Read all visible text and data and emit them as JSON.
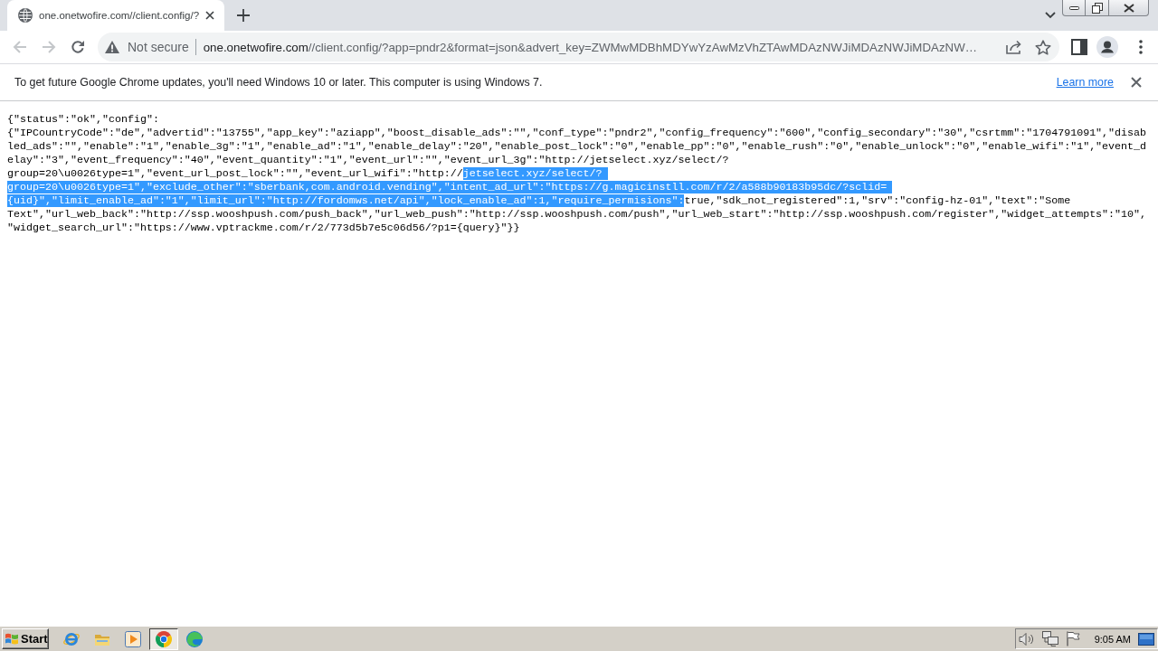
{
  "tab_strip": {
    "tabs": [
      {
        "title": "one.onetwofire.com//client.config/?",
        "selected": true
      }
    ]
  },
  "toolbar": {
    "back": {
      "disabled": true
    },
    "forward": {
      "disabled": true
    },
    "security_label": "Not secure",
    "url": {
      "host": "one.onetwofire.com",
      "path": "//client.config/?app=pndr2&format=json&advert_key=ZWMwMDBhMDYwYzAwMzVhZTAwMDAzNWJiMDAzNWJiMDAzNW…"
    }
  },
  "infobar": {
    "message": "To get future Google Chrome updates, you'll need Windows 10 or later. This computer is using Windows 7.",
    "link": "Learn more"
  },
  "page": {
    "lines": [
      {
        "segments": [
          {
            "text": "{\"status\":\"ok\",\"config\":",
            "selected": false
          }
        ]
      },
      {
        "segments": [
          {
            "text": "{\"IPCountryCode\":\"de\",\"advertid\":\"13755\",\"app_key\":\"aziapp\",\"boost_disable_ads\":\"\",\"conf_type\":\"pndr2\",\"config_frequency\":\"600\",\"config_secondary\":\"30\",\"csrtmm\":\"1704791091\",\"disab",
            "selected": false
          }
        ]
      },
      {
        "segments": [
          {
            "text": "led_ads\":\"\",\"enable\":\"1\",\"enable_3g\":\"1\",\"enable_ad\":\"1\",\"enable_delay\":\"20\",\"enable_post_lock\":\"0\",\"enable_pp\":\"0\",\"enable_rush\":\"0\",\"enable_unlock\":\"0\",\"enable_wifi\":\"1\",\"event_d",
            "selected": false
          }
        ]
      },
      {
        "segments": [
          {
            "text": "elay\":\"3\",\"event_frequency\":\"40\",\"event_quantity\":\"1\",\"event_url\":\"\",\"event_url_3g\":\"http://jetselect.xyz/select/?",
            "selected": false
          }
        ]
      },
      {
        "segments": [
          {
            "text": "group=20\\u0026type=1\",\"event_url_post_lock\":\"\",\"event_url_wifi\":\"http://",
            "selected": false
          },
          {
            "text": "jetselect.xyz/select/?",
            "selected": true
          }
        ]
      },
      {
        "segments": [
          {
            "text": "group=20\\u0026type=1\",\"exclude_other\":\"sberbank,com.android.vending\",\"intent_ad_url\":\"https://g.magicinstll.com/r/2/a588b90183b95dc/?sclid=",
            "selected": true
          }
        ]
      },
      {
        "segments": [
          {
            "text": "{uid}\",\"limit_enable_ad\":\"1\",\"limit_url\":\"http://fordomws.net/api\",\"lock_enable_ad\":1,\"require_permisions\":",
            "selected": true
          },
          {
            "text": "true,\"sdk_not_registered\":1,\"srv\":\"config-hz-01\",\"text\":\"Some",
            "selected": false
          }
        ]
      },
      {
        "segments": [
          {
            "text": "Text\",\"url_web_back\":\"http://ssp.wooshpush.com/push_back\",\"url_web_push\":\"http://ssp.wooshpush.com/push\",\"url_web_start\":\"http://ssp.wooshpush.com/register\",\"widget_attempts\":\"10\",",
            "selected": false
          }
        ]
      },
      {
        "segments": [
          {
            "text": "\"widget_search_url\":\"https://www.vptrackme.com/r/2/773d5b7e5c06d56/?p1={query}\"}}",
            "selected": false
          }
        ]
      }
    ]
  },
  "taskbar": {
    "start_label": "Start",
    "apps": [
      {
        "kind": "ie",
        "selected": false
      },
      {
        "kind": "folder",
        "selected": false
      },
      {
        "kind": "media",
        "selected": false
      },
      {
        "kind": "chrome",
        "selected": true
      },
      {
        "kind": "edge",
        "selected": false
      }
    ],
    "clock": "9:05 AM"
  }
}
